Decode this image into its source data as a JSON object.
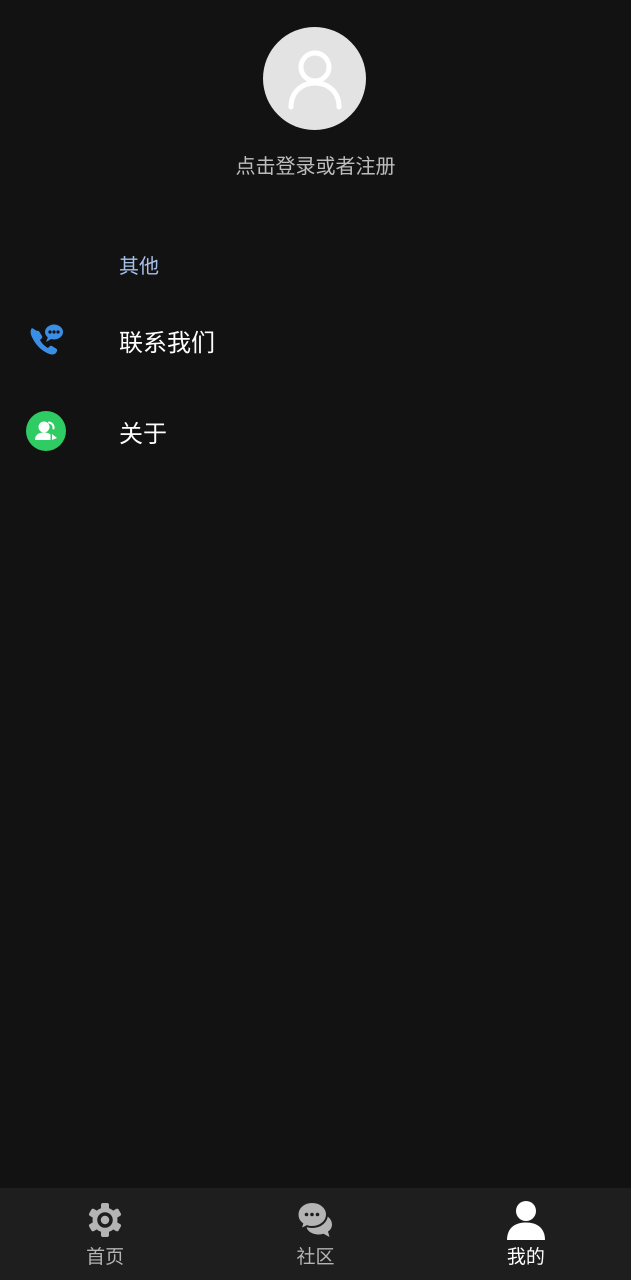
{
  "profile": {
    "login_prompt": "点击登录或者注册",
    "avatar_icon": "person-outline-icon"
  },
  "section": {
    "title": "其他"
  },
  "menu": {
    "items": [
      {
        "label": "联系我们",
        "icon": "phone-chat-icon",
        "icon_color": "#3a8ee6"
      },
      {
        "label": "关于",
        "icon": "about-user-icon",
        "icon_color": "#2ecc63"
      }
    ]
  },
  "bottom_nav": {
    "tabs": [
      {
        "label": "首页",
        "icon": "gear-icon",
        "active": false
      },
      {
        "label": "社区",
        "icon": "chat-bubbles-icon",
        "active": false
      },
      {
        "label": "我的",
        "icon": "person-icon",
        "active": true
      }
    ]
  },
  "colors": {
    "background": "#121212",
    "nav_background": "#1e1e1e",
    "section_title": "#a7c0ea",
    "inactive_tab": "#b4b4b4",
    "active_tab": "#ffffff"
  }
}
